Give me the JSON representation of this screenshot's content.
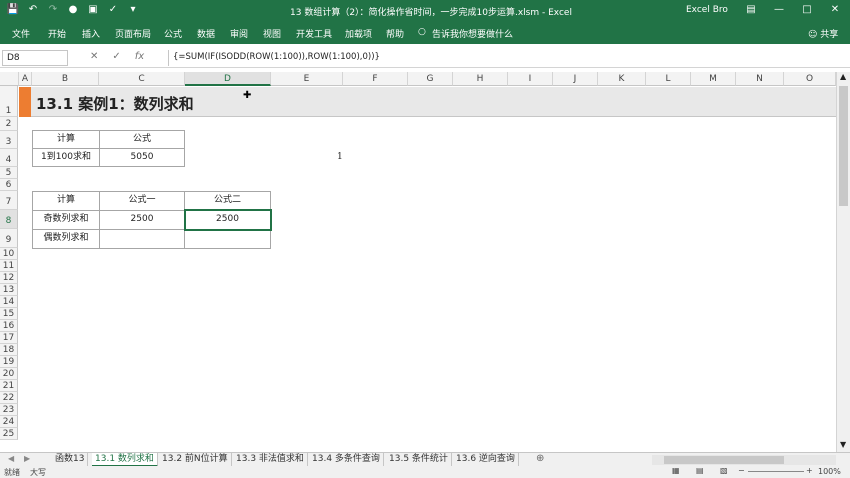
{
  "window": {
    "title": "13 数组计算（2）：简化操作省时间，一步完成10步运算.xlsm  -  Excel",
    "user": "Excel Bro",
    "qat_icons": [
      "save-icon",
      "undo-icon",
      "redo-icon",
      "record-icon",
      "camera-icon",
      "format-painter-icon",
      "customize-icon"
    ],
    "win_buttons": [
      "ribbon-options-icon",
      "minimize-icon",
      "restore-icon",
      "close-icon"
    ]
  },
  "ribbon": {
    "tabs": [
      "文件",
      "开始",
      "插入",
      "页面布局",
      "公式",
      "数据",
      "审阅",
      "视图",
      "开发工具",
      "加载项",
      "帮助"
    ],
    "tell_me": "告诉我你想要做什么",
    "share": "共享"
  },
  "formula_bar": {
    "name_box": "D8",
    "formula": "{=SUM(IF(ISODD(ROW(1:100)),ROW(1:100),0))}"
  },
  "columns": [
    "A",
    "B",
    "C",
    "D",
    "E",
    "F",
    "G",
    "H",
    "I",
    "J",
    "K",
    "L",
    "M",
    "N",
    "O"
  ],
  "rows": [
    "1",
    "2",
    "3",
    "4",
    "5",
    "6",
    "7",
    "8",
    "9",
    "10",
    "11",
    "12",
    "13",
    "14",
    "15",
    "16",
    "17",
    "18",
    "19",
    "20",
    "21",
    "22",
    "23",
    "24",
    "25"
  ],
  "sheet": {
    "banner_title": "13.1 案例1：数列求和",
    "table1": {
      "headers": [
        "计算",
        "公式"
      ],
      "row": [
        "1到100求和",
        "5050"
      ]
    },
    "table2": {
      "headers": [
        "计算",
        "公式一",
        "公式二"
      ],
      "rows": [
        [
          "奇数列求和",
          "2500",
          "2500"
        ],
        [
          "偶数列求和",
          "",
          ""
        ]
      ]
    },
    "stray_text": "1"
  },
  "sheet_tabs": [
    "函数13",
    "13.1 数列求和",
    "13.2 前N位计算",
    "13.3 非法值求和",
    "13.4 多条件查询",
    "13.5 条件统计",
    "13.6 逆向查询"
  ],
  "active_sheet_index": 1,
  "status": {
    "mode": "就绪",
    "caps": "大写",
    "zoom": "100%"
  },
  "colors": {
    "excel_green": "#217346",
    "accent_orange": "#ed7d31"
  }
}
